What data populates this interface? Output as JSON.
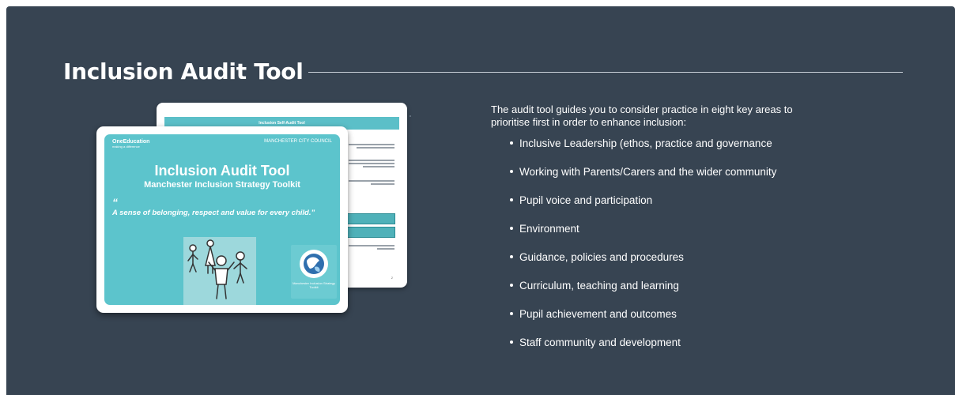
{
  "section": {
    "title": "Inclusion Audit Tool",
    "intro": "The audit tool guides you to consider practice in eight key areas to prioritise first in order to enhance inclusion:",
    "areas": [
      "Inclusive Leadership (ethos, practice and governance",
      "Working with Parents/Carers and the wider community",
      "Pupil voice and participation",
      "Environment",
      "Guidance, policies and procedures",
      "Curriculum, teaching and learning",
      "Pupil achievement and outcomes",
      "Staff community and development"
    ]
  },
  "preview": {
    "back_page": {
      "header": "Inclusion Self-Audit Tool",
      "page_number": "2"
    },
    "front_page": {
      "logo_left": "OneEducation",
      "logo_left_tagline": "making a difference",
      "logo_right": "MANCHESTER CITY COUNCIL",
      "title": "Inclusion Audit Tool",
      "subtitle": "Manchester Inclusion Strategy Toolkit",
      "quote_mark": "“",
      "quote": "A sense of belonging, respect and value for every child.”",
      "badge_text": "Manchester Inclusion Strategy Toolkit"
    }
  },
  "colors": {
    "panel_bg": "#374452",
    "accent_teal": "#5cc4cc",
    "text": "#ffffff"
  },
  "icons": [
    "children-illustration-icon",
    "globe-hands-icon"
  ]
}
